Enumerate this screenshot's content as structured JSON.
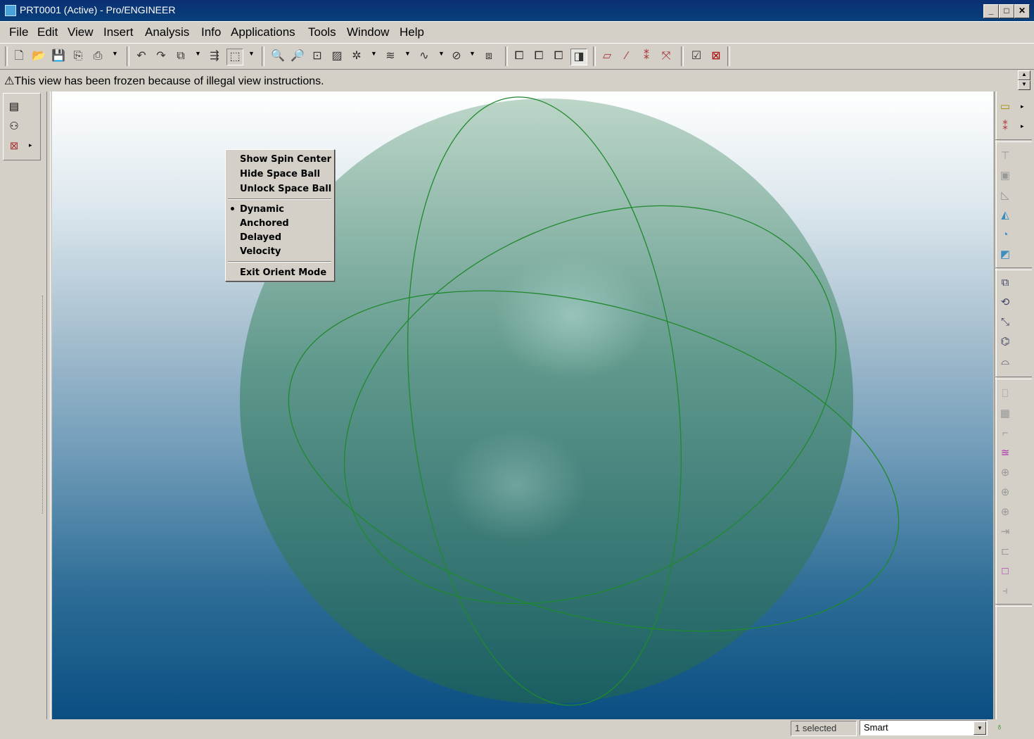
{
  "window": {
    "title": "PRT0001 (Active) - Pro/ENGINEER",
    "minimize": "_",
    "maximize": "□",
    "close": "✕"
  },
  "menubar": {
    "items": [
      "File",
      "Edit",
      "View",
      "Insert",
      "Analysis",
      "Info",
      "Applications",
      "Tools",
      "Window",
      "Help"
    ]
  },
  "toolbar": {
    "icons": [
      "new-icon",
      "open-icon",
      "save-icon",
      "save-copy-icon",
      "print-icon",
      "undo-icon",
      "redo-icon",
      "copy-icon",
      "regenerate-icon",
      "select-box-icon",
      "zoom-in-icon",
      "zoom-out-icon",
      "refit-icon",
      "repaint-icon",
      "spin-center-icon",
      "layers-icon",
      "datum-curve-icon",
      "hide-icon",
      "named-views-icon",
      "wireframe-icon",
      "hidden-line-icon",
      "no-hidden-icon",
      "shaded-icon",
      "datum-plane-icon",
      "datum-axis-icon",
      "datum-point-icon",
      "coordinate-system-icon",
      "window-activate-icon",
      "window-close-icon"
    ]
  },
  "message": {
    "warning_icon": "⚠",
    "text": "This view has been frozen because of illegal view instructions."
  },
  "context_menu": {
    "group1": [
      "Show Spin Center",
      "Hide Space Ball",
      "Unlock Space Ball"
    ],
    "group2": [
      "Dynamic",
      "Anchored",
      "Delayed",
      "Velocity"
    ],
    "selected": "Dynamic",
    "group3": [
      "Exit Orient Mode"
    ]
  },
  "status": {
    "selected": "1 selected",
    "filter": "Smart"
  },
  "colors": {
    "titlebar": "#0a246a",
    "sphere_fill": "#3f8a7c",
    "sphere_lines": "#1f8a2a",
    "background_top": "#ffffff",
    "background_bottom": "#0a4e82"
  }
}
